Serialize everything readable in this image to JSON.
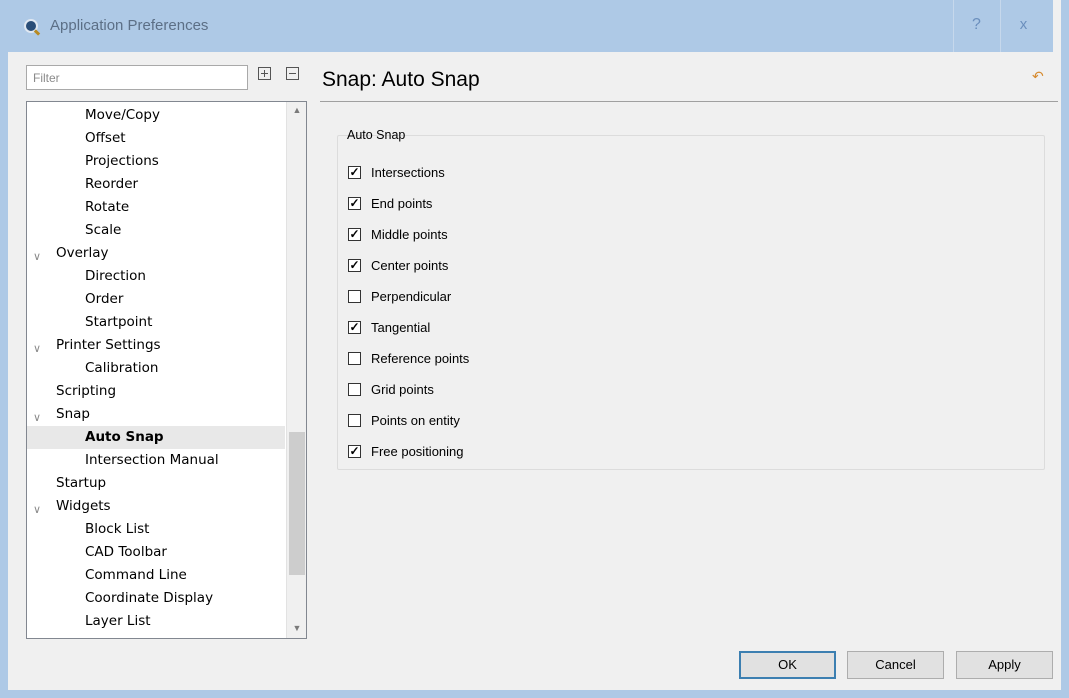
{
  "window": {
    "title": "Application Preferences",
    "help_label": "?",
    "close_label": "x"
  },
  "sidebar": {
    "filter_placeholder": "Filter",
    "items": [
      {
        "label": "Move/Copy",
        "level": 2
      },
      {
        "label": "Offset",
        "level": 2
      },
      {
        "label": "Projections",
        "level": 2
      },
      {
        "label": "Reorder",
        "level": 2
      },
      {
        "label": "Rotate",
        "level": 2
      },
      {
        "label": "Scale",
        "level": 2
      },
      {
        "label": "Overlay",
        "level": 1,
        "expanded": true
      },
      {
        "label": "Direction",
        "level": 2
      },
      {
        "label": "Order",
        "level": 2
      },
      {
        "label": "Startpoint",
        "level": 2
      },
      {
        "label": "Printer Settings",
        "level": 1,
        "expanded": true
      },
      {
        "label": "Calibration",
        "level": 2
      },
      {
        "label": "Scripting",
        "level": 1
      },
      {
        "label": "Snap",
        "level": 1,
        "expanded": true
      },
      {
        "label": "Auto Snap",
        "level": 2,
        "selected": true
      },
      {
        "label": "Intersection Manual",
        "level": 2
      },
      {
        "label": "Startup",
        "level": 1
      },
      {
        "label": "Widgets",
        "level": 1,
        "expanded": true
      },
      {
        "label": "Block List",
        "level": 2
      },
      {
        "label": "CAD Toolbar",
        "level": 2
      },
      {
        "label": "Command Line",
        "level": 2
      },
      {
        "label": "Coordinate Display",
        "level": 2
      },
      {
        "label": "Layer List",
        "level": 2
      }
    ]
  },
  "main": {
    "title": "Snap: Auto Snap",
    "group_title": "Auto Snap",
    "options": [
      {
        "label": "Intersections",
        "checked": true
      },
      {
        "label": "End points",
        "checked": true
      },
      {
        "label": "Middle points",
        "checked": true
      },
      {
        "label": "Center points",
        "checked": true
      },
      {
        "label": "Perpendicular",
        "checked": false
      },
      {
        "label": "Tangential",
        "checked": true
      },
      {
        "label": "Reference points",
        "checked": false
      },
      {
        "label": "Grid points",
        "checked": false
      },
      {
        "label": "Points on entity",
        "checked": false
      },
      {
        "label": "Free positioning",
        "checked": true
      }
    ]
  },
  "footer": {
    "ok_label": "OK",
    "cancel_label": "Cancel",
    "apply_label": "Apply"
  },
  "icons": {
    "app": "app-icon",
    "expand_all": "expand-all-icon",
    "collapse_all": "collapse-all-icon",
    "reset": "undo-icon"
  },
  "colors": {
    "titlebar": "#aec9e6",
    "accent": "#3c7fb1"
  }
}
